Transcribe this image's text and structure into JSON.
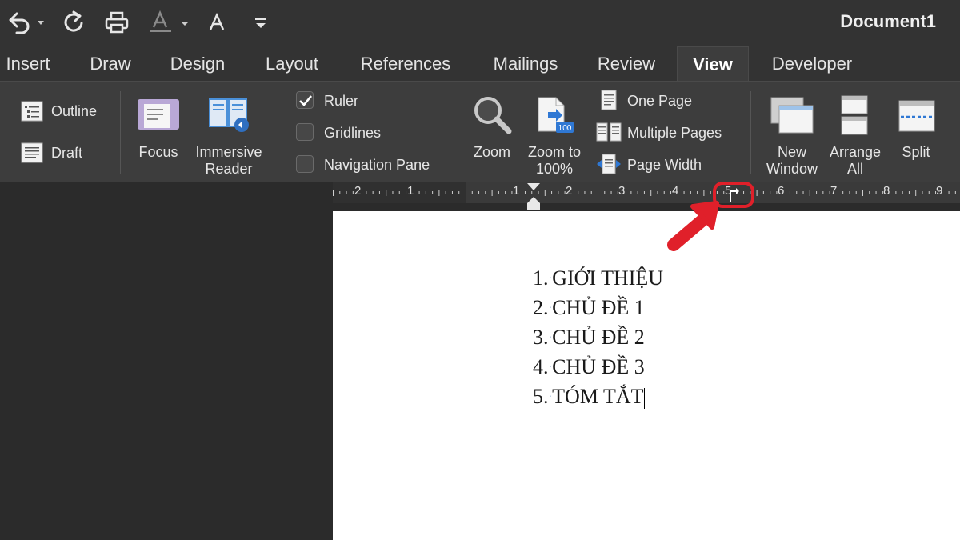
{
  "window": {
    "title": "Document1"
  },
  "tabs": [
    {
      "label": "Insert",
      "active": false
    },
    {
      "label": "Draw",
      "active": false
    },
    {
      "label": "Design",
      "active": false
    },
    {
      "label": "Layout",
      "active": false
    },
    {
      "label": "References",
      "active": false
    },
    {
      "label": "Mailings",
      "active": false
    },
    {
      "label": "Review",
      "active": false
    },
    {
      "label": "View",
      "active": true
    },
    {
      "label": "Developer",
      "active": false
    }
  ],
  "ribbon": {
    "views": {
      "outline": "Outline",
      "draft": "Draft"
    },
    "immersive": {
      "focus": "Focus",
      "reader_line1": "Immersive",
      "reader_line2": "Reader"
    },
    "show": {
      "ruler": "Ruler",
      "gridlines": "Gridlines",
      "nav_pane": "Navigation Pane",
      "ruler_checked": true,
      "gridlines_checked": false,
      "nav_pane_checked": false
    },
    "zoom": {
      "zoom": "Zoom",
      "zoom100_line1": "Zoom to",
      "zoom100_line2": "100%",
      "zoom100_badge": "100",
      "one_page": "One Page",
      "multiple_pages": "Multiple Pages",
      "page_width": "Page Width"
    },
    "window": {
      "new_line1": "New",
      "new_line2": "Window",
      "arrange_line1": "Arrange",
      "arrange_line2": "All",
      "split": "Split"
    }
  },
  "ruler": {
    "left_numbers": [
      "2",
      "1"
    ],
    "right_numbers": [
      "1",
      "2",
      "3",
      "4",
      "5",
      "6",
      "7",
      "8",
      "9"
    ]
  },
  "document": {
    "items": [
      {
        "num": "1.",
        "text": "GIỚI THIỆU"
      },
      {
        "num": "2.",
        "text": "CHỦ ĐỀ 1"
      },
      {
        "num": "3.",
        "text": "CHỦ ĐỀ 2"
      },
      {
        "num": "4.",
        "text": "CHỦ ĐỀ 3"
      },
      {
        "num": "5.",
        "text": "TÓM TẮT"
      }
    ]
  },
  "colors": {
    "annotation": "#e0202a",
    "ribbon_bg": "#3d3d3d",
    "titlebar_bg": "#333333"
  },
  "icons": [
    "undo-icon",
    "redo-icon",
    "print-icon",
    "font-color-icon",
    "font-icon",
    "customize-toolbar-icon",
    "tab-stop-icon"
  ]
}
